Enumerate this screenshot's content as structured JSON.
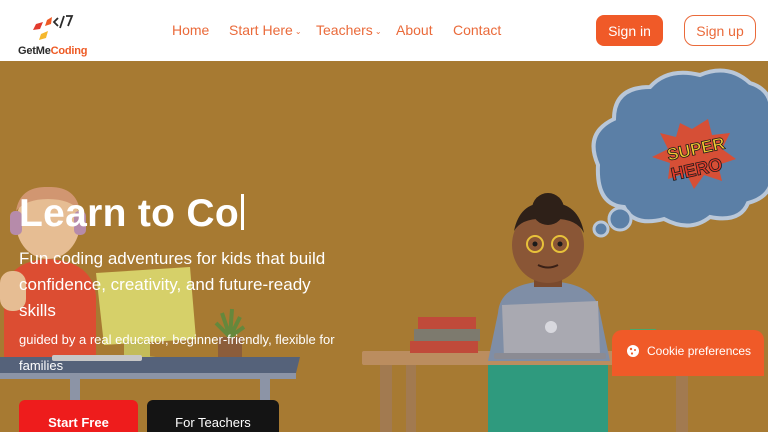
{
  "header": {
    "logo": {
      "get": "GetMe",
      "coding": "Coding"
    },
    "nav": [
      {
        "label": "Home"
      },
      {
        "label": "Start Here"
      },
      {
        "label": "Teachers"
      },
      {
        "label": "About"
      },
      {
        "label": "Contact"
      }
    ],
    "signin_label": "Sign in",
    "signup_label": "Sign up"
  },
  "hero": {
    "title": "Learn to Co",
    "subtitle": "Fun coding adventures for kids that build confidence, creativity, and future-ready skills",
    "note": "guided by a real educator, beginner-friendly, flexible for families",
    "primary_cta": "Start Free",
    "secondary_cta": "For Teachers",
    "bubble_text": [
      "SUPER",
      "HERO"
    ]
  },
  "cookie": {
    "label": "Cookie preferences"
  },
  "colors": {
    "accent": "#f05a28",
    "hero_bg": "#a77a32",
    "nav_text": "#ea6a3a",
    "primary_cta": "#ee1c1c"
  },
  "icons": [
    "logo-mark-icon",
    "chevron-down-icon",
    "cookie-icon"
  ]
}
